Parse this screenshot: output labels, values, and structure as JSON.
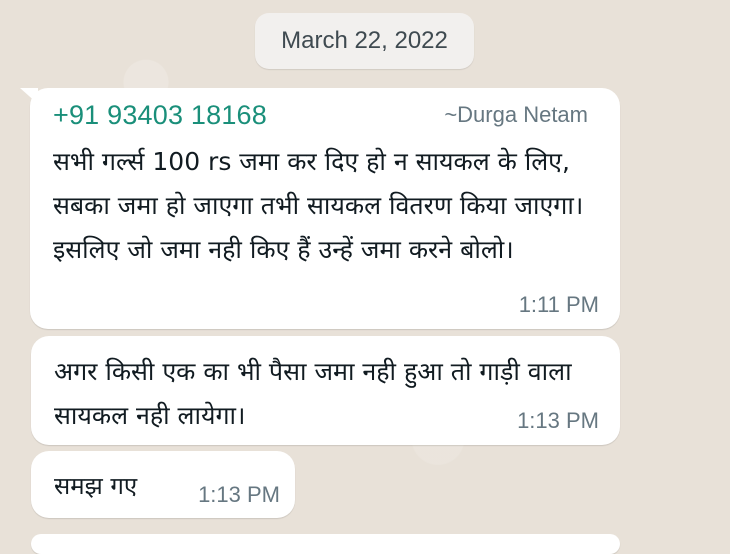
{
  "date_chip": "March 22, 2022",
  "messages": [
    {
      "sender_phone": "+91 93403 18168",
      "sender_name": "~Durga Netam",
      "text": "सभी गर्ल्स 100 rs जमा कर दिए हो न सायकल के लिए, सबका जमा हो जाएगा तभी सायकल वितरण किया जाएगा।इसलिए जो जमा नही किए हैं उन्हें जमा करने बोलो।",
      "time": "1:11 PM"
    },
    {
      "text": "अगर किसी एक का भी पैसा जमा नही हुआ तो गाड़ी वाला सायकल नही लायेगा।",
      "time": "1:13 PM"
    },
    {
      "text": "समझ गए",
      "time": "1:13 PM"
    }
  ],
  "colors": {
    "sender": "#1a8f7a",
    "bubble": "#ffffff",
    "background": "#e8e1d8",
    "meta": "#667781"
  }
}
